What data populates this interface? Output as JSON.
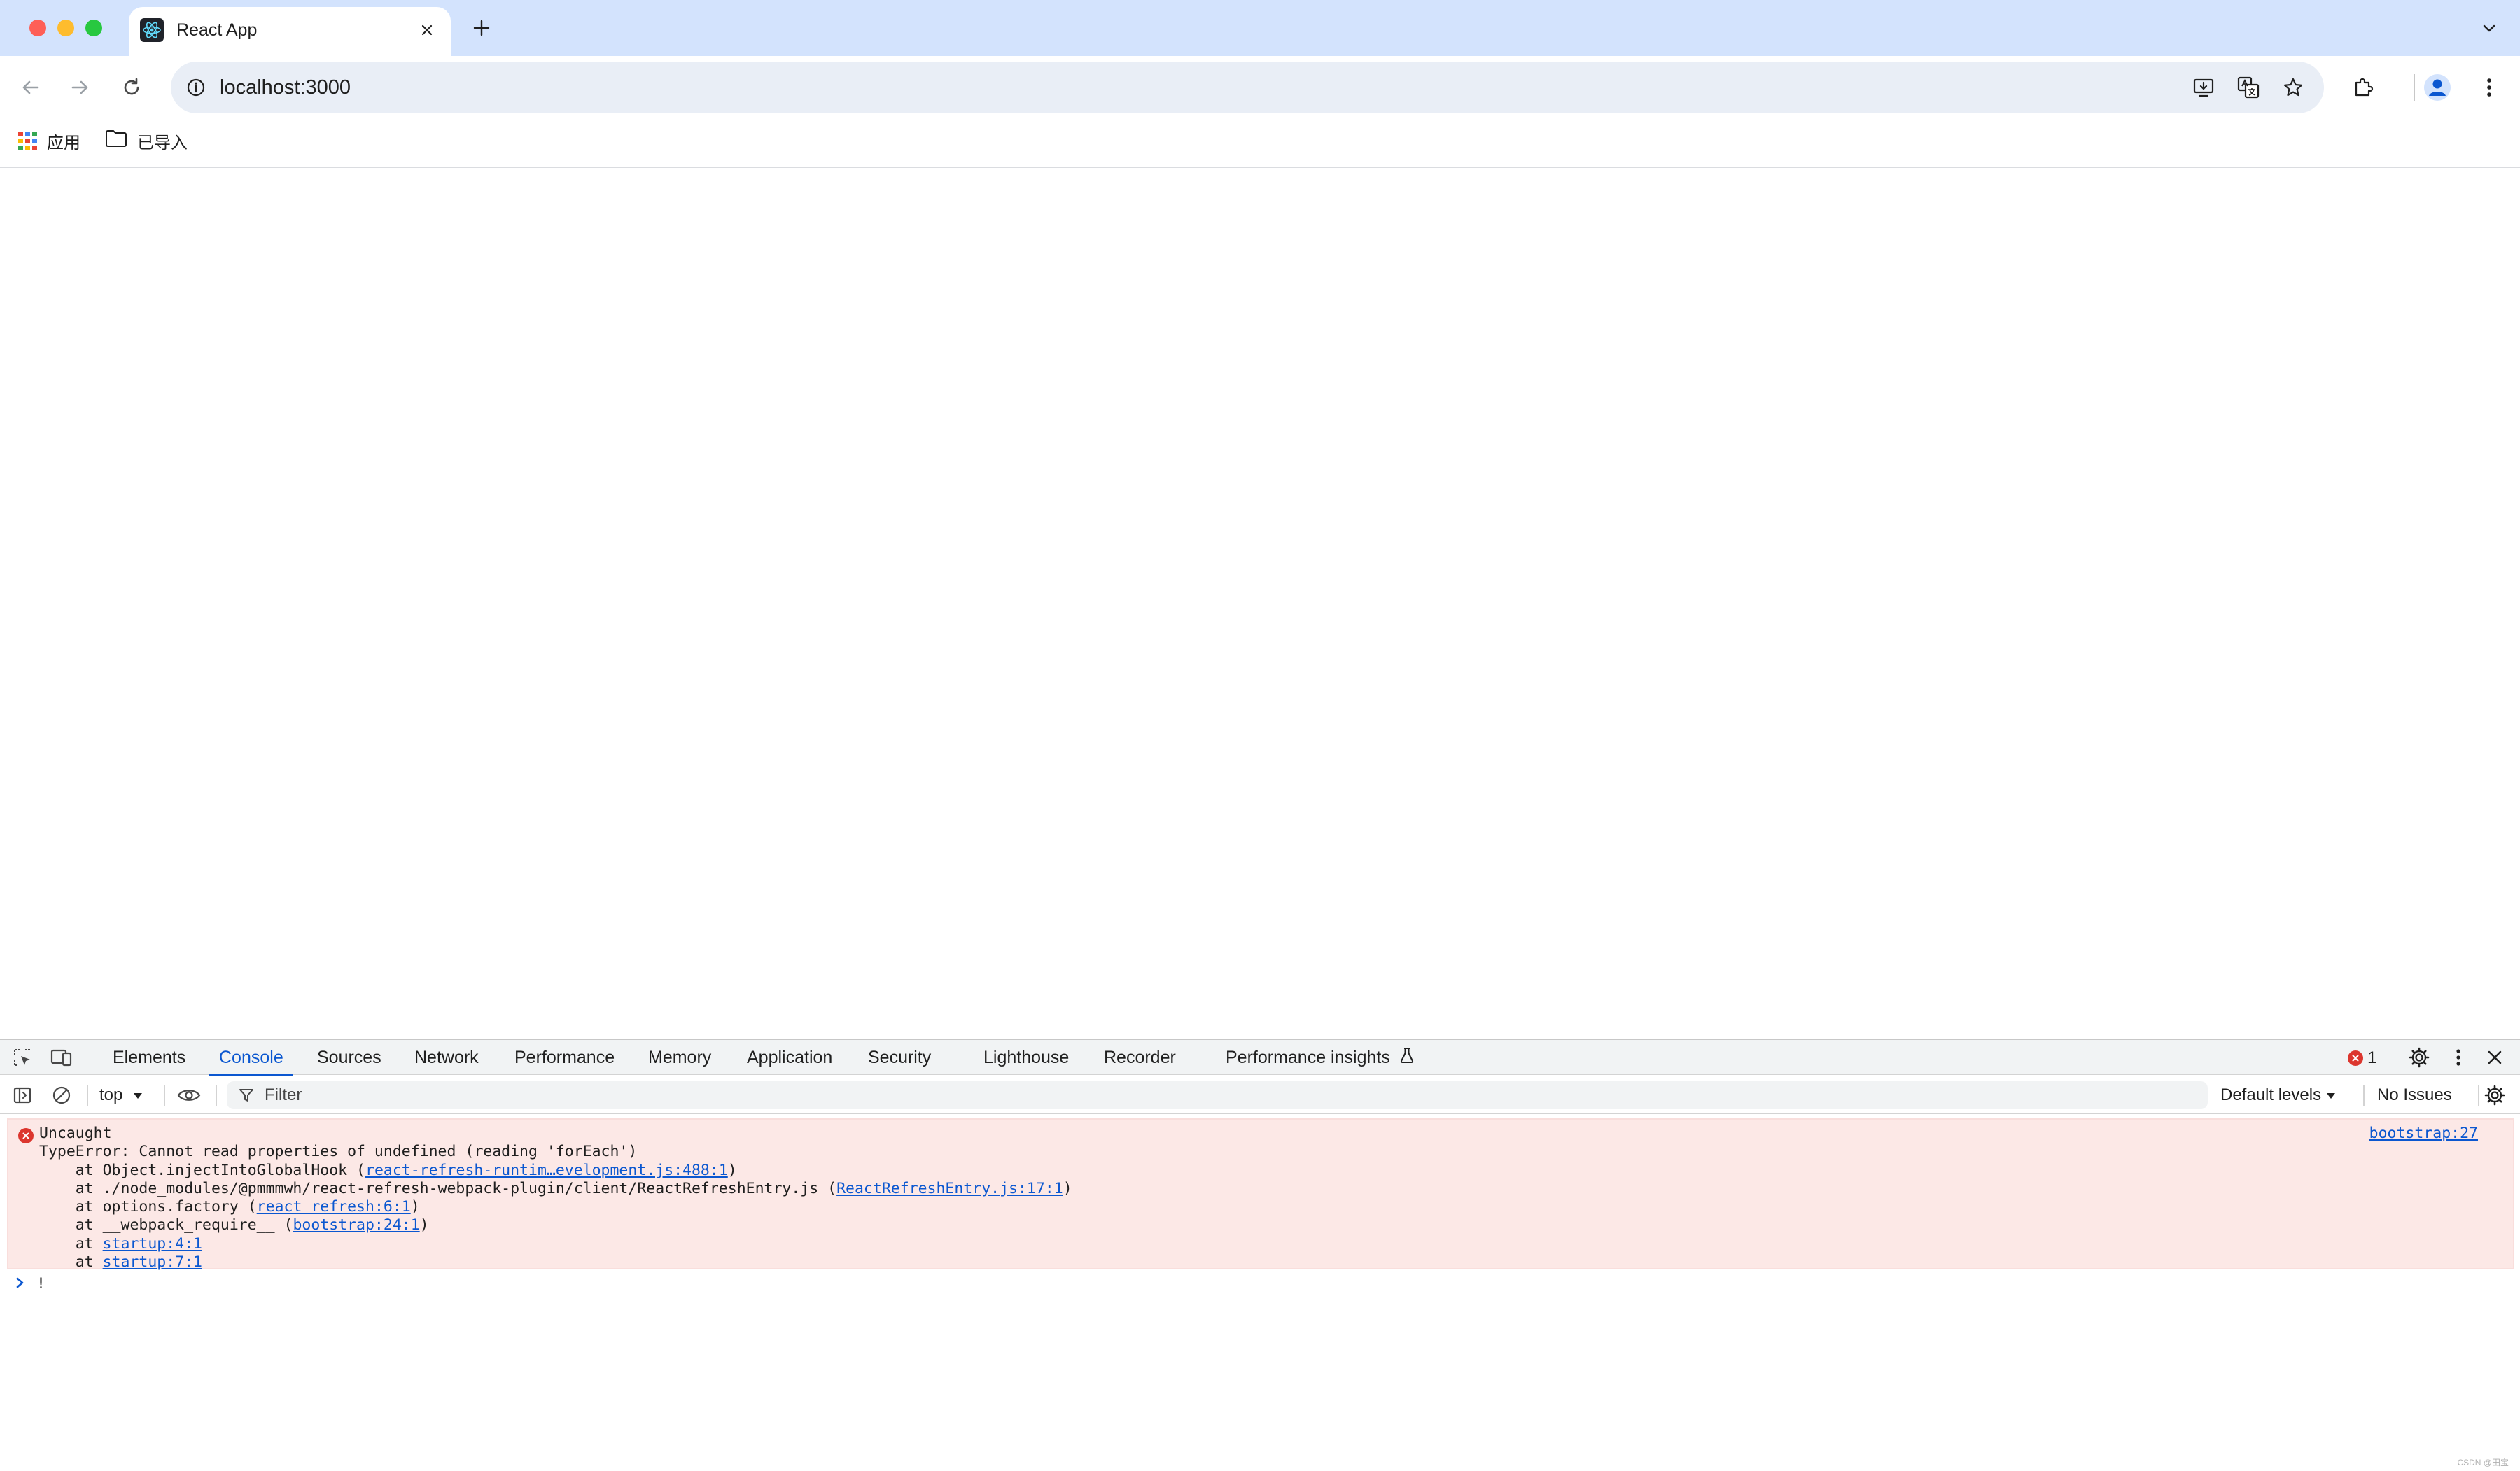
{
  "colors": {
    "tabstrip_bg": "#d3e3fd",
    "accent": "#0b57d0",
    "error_red": "#dc362e",
    "error_bg": "#fce8e6"
  },
  "browser": {
    "tab": {
      "title": "React App",
      "favicon": "react-logo-icon"
    },
    "address": {
      "url": "localhost:3000"
    },
    "bookmarks": [
      {
        "label": "应用",
        "icon": "apps-grid-icon"
      },
      {
        "label": "已导入",
        "icon": "folder-icon"
      }
    ]
  },
  "devtools": {
    "tabs": [
      {
        "label": "Elements"
      },
      {
        "label": "Console",
        "active": true
      },
      {
        "label": "Sources"
      },
      {
        "label": "Network"
      },
      {
        "label": "Performance"
      },
      {
        "label": "Memory"
      },
      {
        "label": "Application"
      },
      {
        "label": "Security"
      },
      {
        "label": "Lighthouse"
      },
      {
        "label": "Recorder"
      },
      {
        "label": "Performance insights"
      }
    ],
    "error_count": "1",
    "context": "top",
    "filter_placeholder": "Filter",
    "levels": "Default levels",
    "issues": "No Issues",
    "console": {
      "error": {
        "title": "Uncaught",
        "message": "TypeError: Cannot read properties of undefined (reading 'forEach')",
        "source": "bootstrap:27",
        "stack": [
          {
            "prefix": "    at Object.injectIntoGlobalHook (",
            "link": "react-refresh-runtim…evelopment.js:488:1",
            "suffix": ")"
          },
          {
            "prefix": "    at ./node_modules/@pmmmwh/react-refresh-webpack-plugin/client/ReactRefreshEntry.js (",
            "link": "ReactRefreshEntry.js:17:1",
            "suffix": ")"
          },
          {
            "prefix": "    at options.factory (",
            "link": "react refresh:6:1",
            "suffix": ")"
          },
          {
            "prefix": "    at __webpack_require__ (",
            "link": "bootstrap:24:1",
            "suffix": ")"
          },
          {
            "prefix": "    at ",
            "link": "startup:4:1",
            "suffix": ""
          },
          {
            "prefix": "    at ",
            "link": "startup:7:1",
            "suffix": ""
          }
        ]
      },
      "prompt_text": "!"
    }
  },
  "watermark": "CSDN @田宝"
}
